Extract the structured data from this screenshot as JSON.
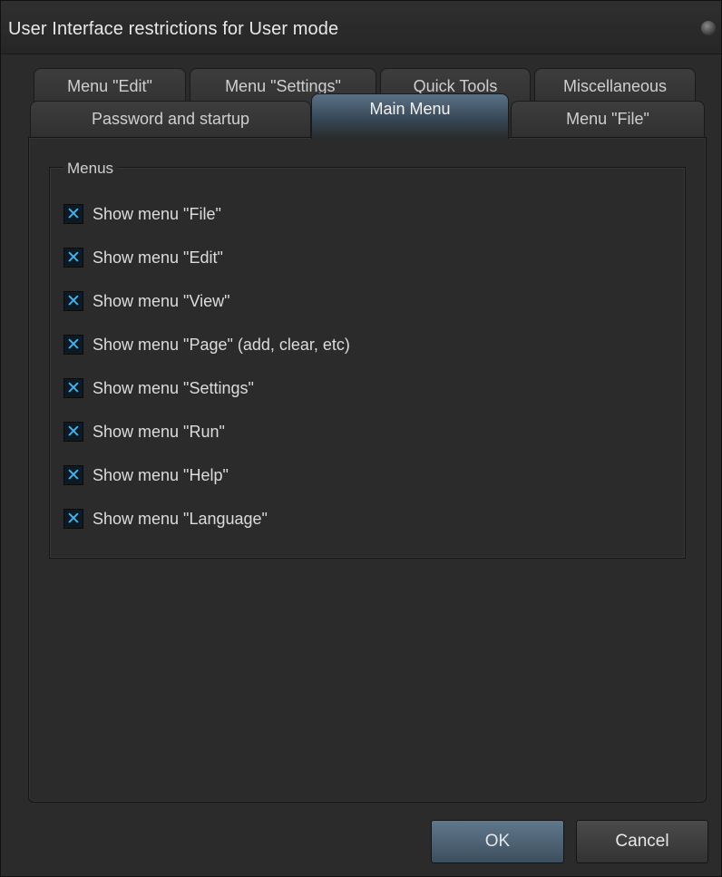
{
  "window": {
    "title": "User Interface restrictions for User mode"
  },
  "tabs": {
    "row1": [
      {
        "label": "Menu \"Edit\""
      },
      {
        "label": "Menu \"Settings\""
      },
      {
        "label": "Quick Tools"
      },
      {
        "label": "Miscellaneous"
      }
    ],
    "row2": [
      {
        "label": "Password and startup"
      },
      {
        "label": "Main Menu",
        "active": true
      },
      {
        "label": "Menu \"File\""
      }
    ]
  },
  "menus_group": {
    "legend": "Menus",
    "items": [
      {
        "label": "Show menu \"File\"",
        "checked": true
      },
      {
        "label": "Show menu \"Edit\"",
        "checked": true
      },
      {
        "label": "Show menu \"View\"",
        "checked": true
      },
      {
        "label": "Show menu \"Page\" (add, clear, etc)",
        "checked": true
      },
      {
        "label": "Show menu \"Settings\"",
        "checked": true
      },
      {
        "label": "Show menu \"Run\"",
        "checked": true
      },
      {
        "label": "Show menu \"Help\"",
        "checked": true
      },
      {
        "label": "Show menu \"Language\"",
        "checked": true
      }
    ],
    "check_glyph": "✕"
  },
  "buttons": {
    "ok": "OK",
    "cancel": "Cancel"
  },
  "colors": {
    "accent": "#3fb8ee",
    "active_tab": "#5a7186"
  }
}
